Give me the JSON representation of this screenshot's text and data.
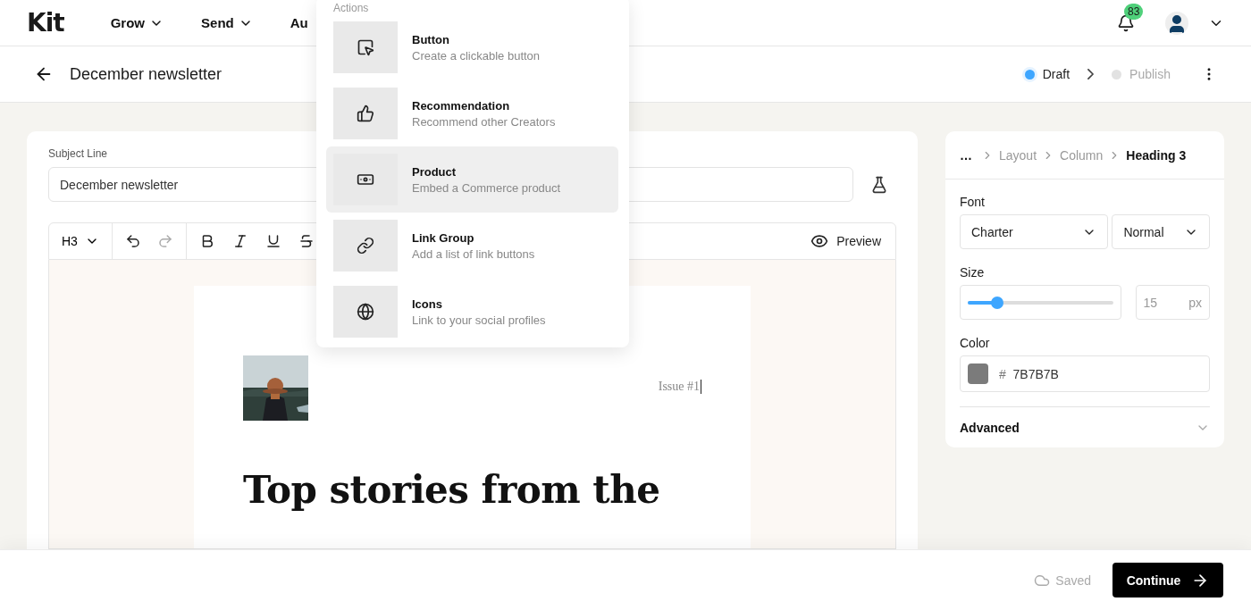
{
  "nav": {
    "logo": "Kit",
    "items": [
      {
        "label": "Grow",
        "has_menu": true
      },
      {
        "label": "Send",
        "has_menu": true
      },
      {
        "label": "Au",
        "has_menu": false
      }
    ],
    "notifications": "83"
  },
  "header": {
    "title": "December newsletter",
    "steps": [
      {
        "label": "Draft",
        "current": true
      },
      {
        "label": "Publish",
        "current": false
      }
    ]
  },
  "editor": {
    "subject_label": "Subject Line",
    "subject_value": "December newsletter",
    "heading_select": "H3",
    "tools": [
      {
        "disabled": false
      },
      {
        "disabled": true
      },
      {
        "disabled": false
      },
      {
        "disabled": false
      },
      {
        "disabled": false
      },
      {
        "disabled": false
      }
    ],
    "preview": "Preview",
    "document": {
      "issue": "Issue #1",
      "heading": "Top stories from the"
    }
  },
  "menu": {
    "title": "Actions",
    "items": [
      {
        "title": "Button",
        "description": "Create a clickable button",
        "selected": false
      },
      {
        "title": "Recommendation",
        "description": "Recommend other Creators",
        "selected": false
      },
      {
        "title": "Product",
        "description": "Embed a Commerce product",
        "selected": true
      },
      {
        "title": "Link Group",
        "description": "Add a list of link buttons",
        "selected": false
      },
      {
        "title": "Icons",
        "description": "Link to your social profiles",
        "selected": false
      }
    ]
  },
  "panel": {
    "breadcrumb_more": "…",
    "breadcrumb": [
      {
        "label": "Layout",
        "current": false
      },
      {
        "label": "Column",
        "current": false
      },
      {
        "label": "Heading 3",
        "current": true
      }
    ],
    "font_label": "Font",
    "font": "Charter",
    "weight": "Normal",
    "size_label": "Size",
    "size": {
      "level": 0.2,
      "value": "15",
      "unit": "px"
    },
    "color_label": "Color",
    "color": {
      "hash": "#",
      "value": "7B7B7B",
      "color": "#7b7b7b"
    },
    "advanced": {
      "label": "Advanced",
      "expanded": false
    }
  },
  "footer": {
    "status": "Saved",
    "continue": "Continue"
  }
}
